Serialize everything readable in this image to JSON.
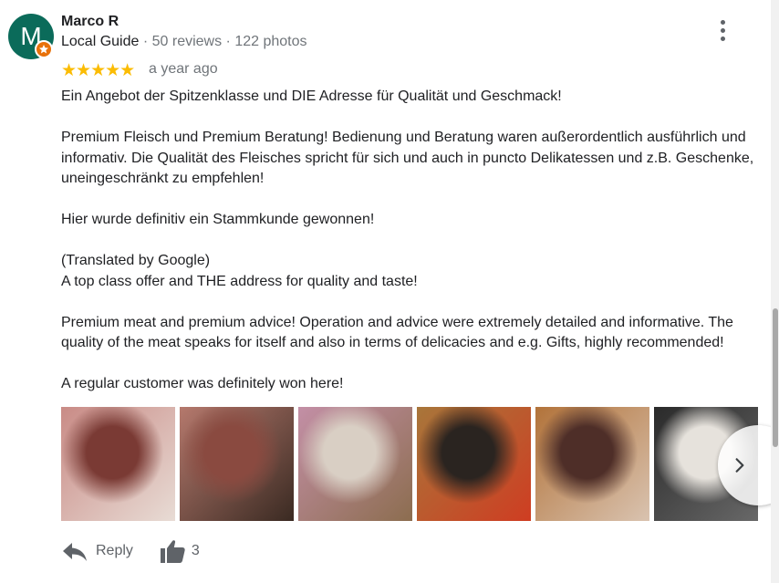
{
  "reviewer": {
    "avatar_letter": "M",
    "name": "Marco R",
    "badge": "Local Guide",
    "reviews": "· 50 reviews",
    "photos": "· 122 photos"
  },
  "rating": {
    "stars_filled": 5,
    "stars_total": 5,
    "star_glyphs": "★★★★★",
    "time": "a year ago"
  },
  "review_paragraphs": [
    "Ein Angebot der Spitzenklasse und DIE Adresse für Qualität und Geschmack!",
    "Premium Fleisch und Premium Beratung! Bedienung und Beratung waren außerordentlich ausführlich und informativ. Die Qualität des Fleisches spricht für sich und auch in puncto Delikatessen und z.B. Geschenke, uneingeschränkt zu empfehlen!",
    "Hier wurde definitiv ein Stammkunde gewonnen!",
    "(Translated by Google)\nA top class offer and THE address for quality and taste!",
    "Premium meat and premium advice! Operation and advice were extremely detailed and informative. The quality of the meat speaks for itself and also in terms of delicacies and e.g. Gifts, highly recommended!",
    "A regular customer was definitely won here!"
  ],
  "photos": [
    {
      "name": "photo-steak-1",
      "colors": [
        "#7a3a34",
        "#c98b86",
        "#e8dcd5"
      ]
    },
    {
      "name": "photo-steak-2",
      "colors": [
        "#8a4a40",
        "#b5796d",
        "#3a2a22"
      ]
    },
    {
      "name": "photo-gift-boxes",
      "colors": [
        "#d9cfc4",
        "#c38fa6",
        "#8c6d4f"
      ]
    },
    {
      "name": "photo-jar",
      "colors": [
        "#2a2420",
        "#a8763a",
        "#cf3d22"
      ]
    },
    {
      "name": "photo-bottles",
      "colors": [
        "#4e2e28",
        "#b2733a",
        "#d9c3b0"
      ]
    },
    {
      "name": "photo-gift-set",
      "colors": [
        "#e6e2dc",
        "#2a2a2a",
        "#6b6b6b"
      ]
    }
  ],
  "actions": {
    "reply_label": "Reply",
    "like_count": "3"
  },
  "colors": {
    "star": "#fbbc04",
    "avatar": "#0b6b5a",
    "local_guide_badge": "#e8710a",
    "secondary_text": "#70757a",
    "icon": "#5f6368"
  }
}
